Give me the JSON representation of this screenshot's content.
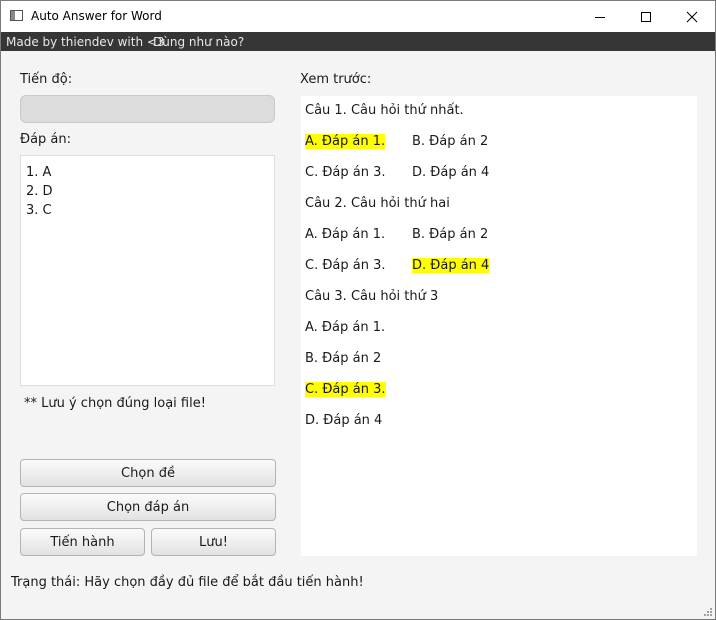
{
  "window": {
    "title": "Auto Answer for Word"
  },
  "menubar": {
    "credit": "Made by thiendev with <3",
    "help": "Dùng như nào?"
  },
  "left": {
    "progress_label": "Tiến độ:",
    "progress_value": 0,
    "answers_label": "Đáp án:",
    "answers": [
      "1. A",
      "2. D",
      "3. C"
    ],
    "note": "** Lưu ý chọn đúng loại file!",
    "buttons": {
      "choose_exam": "Chọn đề",
      "choose_answers": "Chọn đáp án",
      "run": "Tiến hành",
      "save": "Lưu!"
    }
  },
  "preview": {
    "label": "Xem trước:",
    "q1": {
      "question": "Câu 1. Câu hỏi thứ nhất.",
      "a": "A. Đáp án 1.",
      "b": "B. Đáp án 2",
      "c": "C. Đáp án 3.",
      "d": "D. Đáp án 4"
    },
    "q2": {
      "question": "Câu 2. Câu hỏi thứ hai",
      "a": "A. Đáp án 1.",
      "b": "B. Đáp án 2",
      "c": "C. Đáp án 3.",
      "d": "D. Đáp án 4"
    },
    "q3": {
      "question": "Câu 3. Câu hỏi thứ 3",
      "a": "A. Đáp án 1.",
      "b": "B. Đáp án 2",
      "c": "C. Đáp án 3.",
      "d": "D. Đáp án 4"
    },
    "highlight_color": "#ffff00"
  },
  "status": {
    "text": "Trạng thái: Hãy chọn đầy đủ file để bắt đầu tiến hành!"
  }
}
